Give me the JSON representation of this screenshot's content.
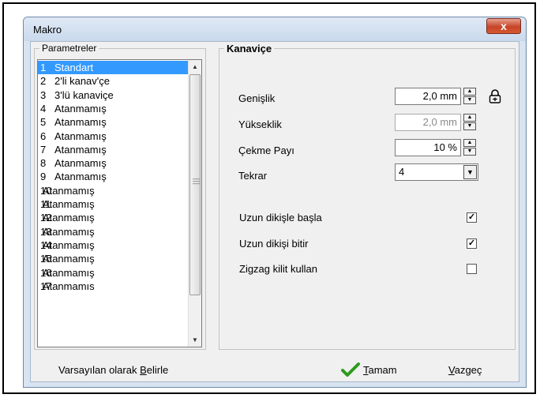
{
  "window": {
    "title": "Makro",
    "close_glyph": "x"
  },
  "parameters": {
    "legend": "Parametreler",
    "items": [
      {
        "num": "1",
        "label": "Standart",
        "selected": true
      },
      {
        "num": "2",
        "label": "2'li kanav'çe"
      },
      {
        "num": "3",
        "label": "3'lü kanaviçe"
      },
      {
        "num": "4",
        "label": "Atanmamış"
      },
      {
        "num": "5",
        "label": "Atanmamış"
      },
      {
        "num": "6",
        "label": "Atanmamış"
      },
      {
        "num": "7",
        "label": "Atanmamış"
      },
      {
        "num": "8",
        "label": "Atanmamış"
      },
      {
        "num": "9",
        "label": "Atanmamış"
      },
      {
        "num": "10",
        "label": "Atanmamış"
      },
      {
        "num": "11",
        "label": "Atanmamış"
      },
      {
        "num": "12",
        "label": "Atanmamış"
      },
      {
        "num": "13",
        "label": "Atanmamış"
      },
      {
        "num": "14",
        "label": "Atanmamış"
      },
      {
        "num": "15",
        "label": "Atanmamış"
      },
      {
        "num": "16",
        "label": "Atanmamış"
      },
      {
        "num": "17",
        "label": "Atanmamıs"
      }
    ]
  },
  "settings": {
    "legend": "Kanaviçe",
    "width_label": "Genişlik",
    "width_value": "2,0 mm",
    "height_label": "Yükseklik",
    "height_value": "2,0 mm",
    "pull_label": "Çekme Payı",
    "pull_value": "10 %",
    "repeat_label": "Tekrar",
    "repeat_value": "4",
    "long_start_label": "Uzun dikişle başla",
    "long_start_checked": true,
    "long_end_label": "Uzun dikişi bitir",
    "long_end_checked": true,
    "zigzag_label": "Zigzag kilit kullan",
    "zigzag_checked": false
  },
  "footer": {
    "default_pre": "Varsayılan olarak ",
    "default_key": "B",
    "default_post": "elirle",
    "ok_key": "T",
    "ok_post": "amam",
    "cancel_key": "V",
    "cancel_post": "azgeç"
  },
  "icons": {
    "lock": "lock-icon",
    "ok": "checkmark-icon"
  },
  "colors": {
    "selection": "#3399ff",
    "close": "#c6452a",
    "ok_check": "#2e9a1f"
  }
}
